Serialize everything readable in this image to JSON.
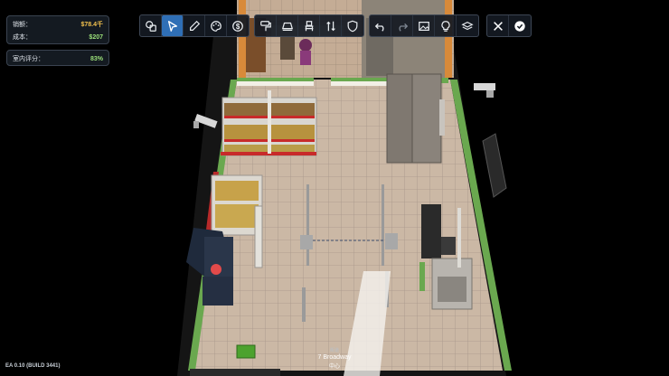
{
  "stats": {
    "sales_label": "销额：",
    "sales_value": "$78.4千",
    "cost_label": "成本：",
    "cost_value": "$207",
    "rating_label": "室内评分：",
    "rating_value": "83%"
  },
  "toolbar": {
    "group_a": [
      "layers-icon",
      "pointer-icon",
      "eyedropper-icon",
      "palette-icon",
      "dollar-icon"
    ],
    "group_b": [
      "paint-roller-icon",
      "conveyor-icon",
      "chair-icon",
      "arrows-icon",
      "shield-icon"
    ],
    "group_c": [
      "undo-icon",
      "redo-icon",
      "image-icon",
      "lightbulb-icon",
      "floor-icon"
    ],
    "group_d": [
      "close-icon",
      "confirm-icon"
    ],
    "active_tool": "pointer-icon"
  },
  "footer": {
    "build": "EA 0.10 (BUILD 3441)",
    "location_small": "街道",
    "location_name": "7 Broadway",
    "location_sub": "中心"
  },
  "colors": {
    "accent": "#2f6fb6",
    "sales": "#f2c14e",
    "positive": "#9be07a",
    "panel": "#161c24"
  }
}
